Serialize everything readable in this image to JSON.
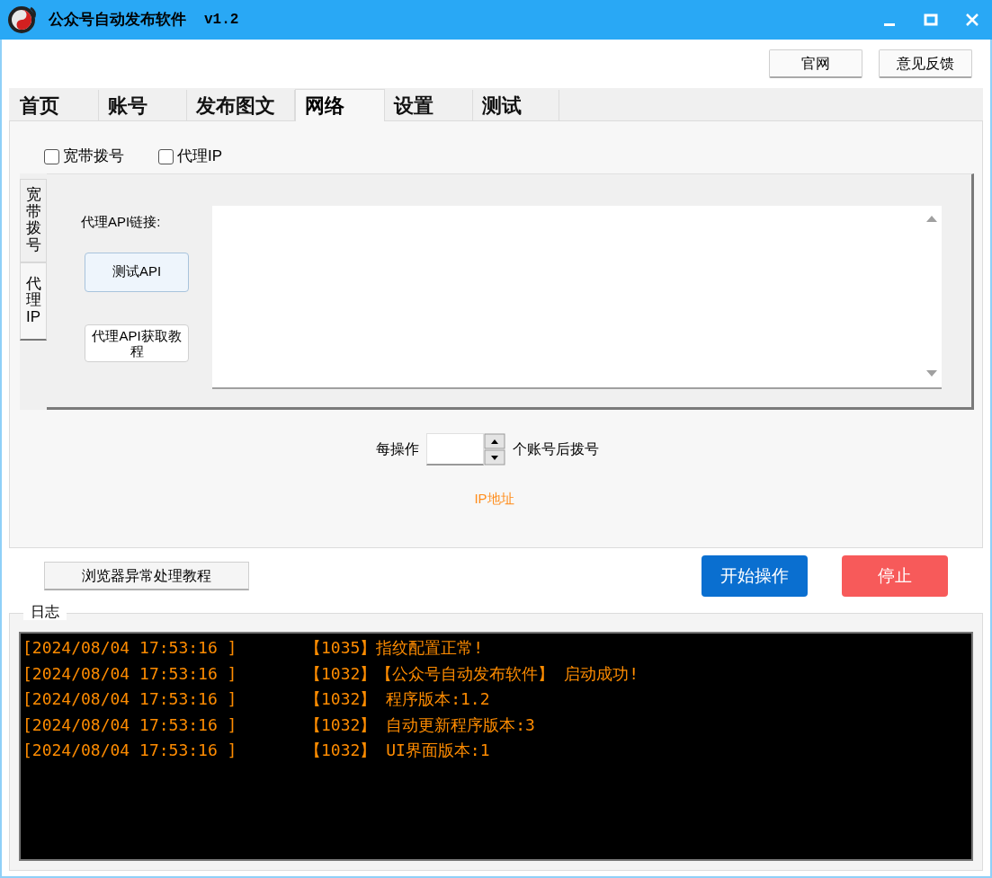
{
  "window": {
    "title": "公众号自动发布软件",
    "version": "v1.2"
  },
  "top_buttons": [
    "官网",
    "意见反馈"
  ],
  "tabs": [
    {
      "label": "首页",
      "selected": false
    },
    {
      "label": "账号",
      "selected": false
    },
    {
      "label": "发布图文",
      "selected": false
    },
    {
      "label": "网络",
      "selected": true
    },
    {
      "label": "设置",
      "selected": false
    },
    {
      "label": "测试",
      "selected": false
    }
  ],
  "options": [
    {
      "label": "宽带拨号",
      "checked": false
    },
    {
      "label": "代理IP",
      "checked": false
    }
  ],
  "side_tabs": [
    {
      "label": "宽带拨号",
      "selected": false
    },
    {
      "label": "代理IP",
      "selected": true
    }
  ],
  "proxy": {
    "link_label": "代理API链接:",
    "test_button": "测试API",
    "tutorial_button": "代理API获取教程"
  },
  "dial": {
    "before": "每操作",
    "after": "个账号后拨号"
  },
  "ip_label": "IP地址",
  "browser_button": "浏览器异常处理教程",
  "start_button": "开始操作",
  "stop_button": "停止",
  "log": {
    "title": "日志",
    "lines": [
      {
        "time": "[2024/08/04 17:53:16 ]",
        "message": "【1035】指纹配置正常!"
      },
      {
        "time": "[2024/08/04 17:53:16 ]",
        "message": "【1032】【公众号自动发布软件】 启动成功!"
      },
      {
        "time": "[2024/08/04 17:53:16 ]",
        "message": "【1032】 程序版本:1.2"
      },
      {
        "time": "[2024/08/04 17:53:16 ]",
        "message": "【1032】 自动更新程序版本:3"
      },
      {
        "time": "[2024/08/04 17:53:16 ]",
        "message": "【1032】 UI界面版本:1"
      }
    ]
  }
}
